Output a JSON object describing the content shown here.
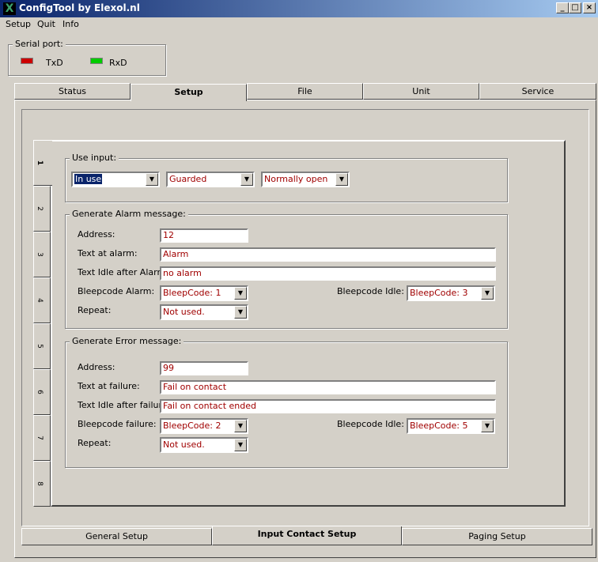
{
  "window": {
    "title": "ConfigTool by Elexol.nl",
    "icon": "X",
    "minimize": "_",
    "maximize": "□",
    "close": "×"
  },
  "menu": [
    "Setup",
    "Quit",
    "Info"
  ],
  "serial": {
    "legend": "Serial port:",
    "txd": "TxD",
    "rxd": "RxD",
    "txd_color": "#cc0000",
    "rxd_color": "#00cc00"
  },
  "top_tabs": [
    "Status",
    "Setup",
    "File",
    "Unit",
    "Service"
  ],
  "side_tabs": [
    "1",
    "2",
    "3",
    "4",
    "5",
    "6",
    "7",
    "8"
  ],
  "use_input": {
    "legend": "Use input:",
    "in_use": "In use",
    "guarded": "Guarded",
    "normally": "Normally open"
  },
  "alarm": {
    "legend": "Generate Alarm message:",
    "address_label": "Address:",
    "address": "12",
    "text_label": "Text at alarm:",
    "text": "Alarm",
    "idle_label": "Text Idle after Alarm:",
    "idle": "no alarm",
    "bleep_label": "Bleepcode Alarm:",
    "bleep": "BleepCode: 1",
    "bleep_idle_label": "Bleepcode Idle:",
    "bleep_idle": "BleepCode: 3",
    "repeat_label": "Repeat:",
    "repeat": "Not used."
  },
  "error": {
    "legend": "Generate Error message:",
    "address_label": "Address:",
    "address": "99",
    "text_label": "Text at failure:",
    "text": "Fail on contact",
    "idle_label": "Text Idle after failure:",
    "idle": "Fail on contact ended",
    "bleep_label": "Bleepcode failure:",
    "bleep": "BleepCode: 2",
    "bleep_idle_label": "Bleepcode Idle:",
    "bleep_idle": "BleepCode: 5",
    "repeat_label": "Repeat:",
    "repeat": "Not used."
  },
  "bottom_tabs": [
    "General Setup",
    "Input Contact Setup",
    "Paging Setup"
  ]
}
